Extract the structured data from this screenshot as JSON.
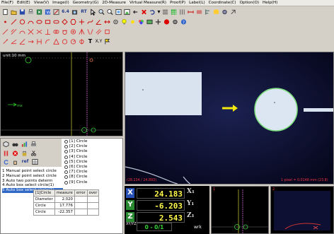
{
  "menu": [
    "File(F)",
    "Edit(E)",
    "View(V)",
    "Image(I)",
    "Geometry(G)",
    "2D-Measure",
    "Virtual Measure(R)",
    "Proof(P)",
    "Label(L)",
    "Coordinate(C)",
    "Option(O)",
    "Help(H)"
  ],
  "toolbar": {
    "zoom_label": "6.4",
    "rt_label": "RT",
    "ref_label": "ref"
  },
  "left_view": {
    "unit_label": "unit:10 mm"
  },
  "circle_list": [
    "[1] Circle",
    "[2] Circle",
    "[3] Circle",
    "[4] Circle",
    "[5] Circle",
    "[6] Circle",
    "[7] Circle",
    "[8] Circle",
    "[9] Circle"
  ],
  "history": [
    "1 Manual point select circle",
    "2 Manual point select circle",
    "3 Auto two points determ",
    "4 Auto box select circle(1)",
    "5 Auto box select circle(1)"
  ],
  "measure_table": {
    "head": [
      "[1]Circle",
      "measure",
      "error",
      "over"
    ],
    "rows": [
      [
        "Diameter",
        "2.020",
        "",
        ""
      ],
      [
        "Circle",
        "17.776",
        "",
        ""
      ],
      [
        "Circle",
        "-22.357",
        "",
        ""
      ]
    ]
  },
  "main_view": {
    "coords_left": "(28.234 / 24.893)",
    "pixel_info": "1 pixel = 0.0146 mm  (23.8)"
  },
  "dro": {
    "x_axis": "X",
    "x_value": "24.183",
    "x_axis2": "X₁",
    "y_axis": "Y",
    "y_value": "-6.203",
    "y_axis2": "Y₁",
    "z_axis": "Z",
    "z_value": "2.543",
    "z_axis2": "Z₁",
    "counter": "0 - 0/1",
    "xyz_label": "XY/YZ",
    "wrk_label": "wrk"
  },
  "mini_views": {
    "label1": "1",
    "label2": "2"
  },
  "colors": {
    "dro_value": "#fff94a",
    "counter": "#31d231",
    "selection": "#3169c6",
    "main_bg": "#0a0c26"
  }
}
